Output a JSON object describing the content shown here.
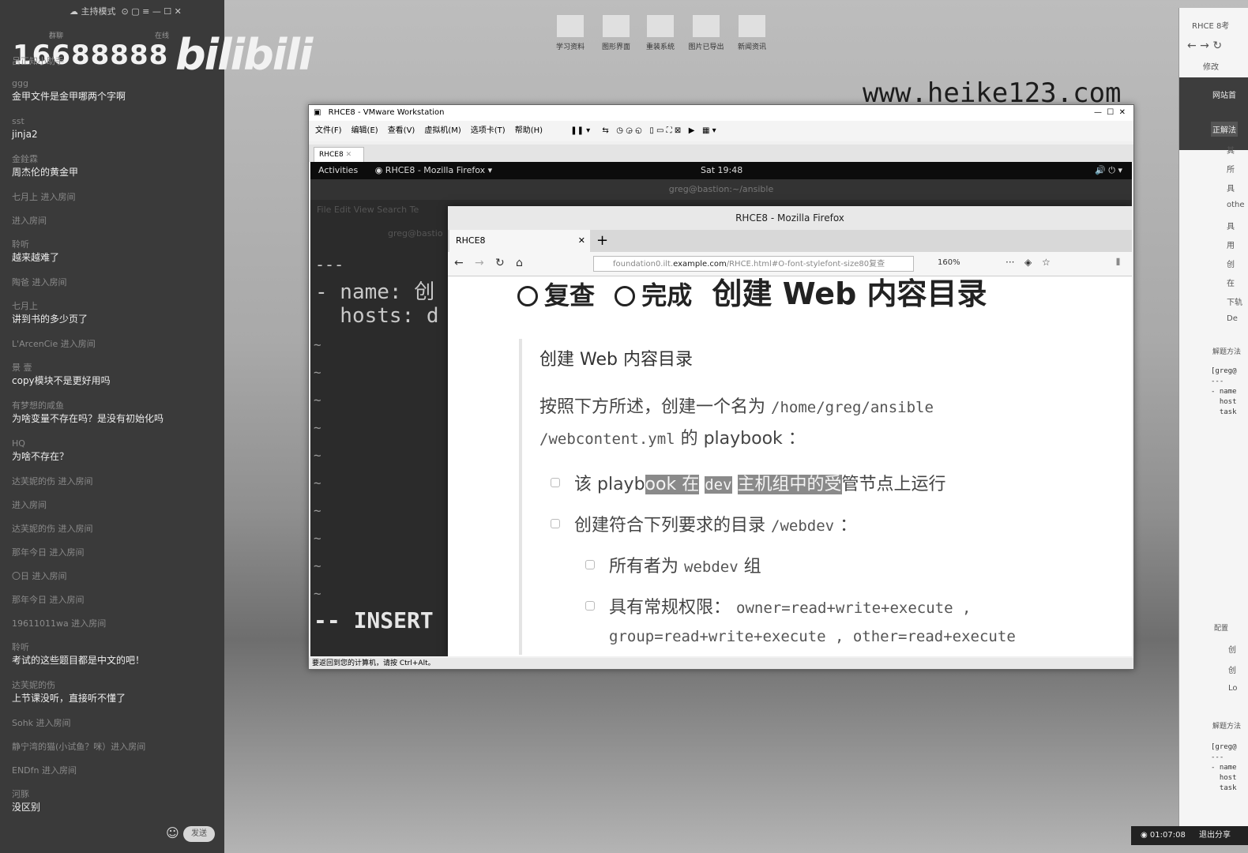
{
  "chat": {
    "top_label": "主持模式",
    "hdr_left": "群聊",
    "hdr_right": "在线",
    "counter": "16688888",
    "logo": "bilibili",
    "messages": [
      {
        "user": "吕正知小助手",
        "text": "",
        "join": ""
      },
      {
        "user": "ggg",
        "text": "金甲文件是金甲哪两个字啊",
        "join": ""
      },
      {
        "user": "sst",
        "text": "jinja2",
        "join": ""
      },
      {
        "user": "金銓霖",
        "text": "周杰伦的黄金甲",
        "join": ""
      },
      {
        "user": "",
        "text": "",
        "join": "七月上 进入房间"
      },
      {
        "user": "",
        "text": "",
        "join": "进入房间"
      },
      {
        "user": "聆听",
        "text": "越来越难了",
        "join": ""
      },
      {
        "user": "",
        "text": "",
        "join": "陶爸 进入房间"
      },
      {
        "user": "七月上",
        "text": "讲到书的多少页了",
        "join": ""
      },
      {
        "user": "",
        "text": "",
        "join": "L'ArcenCie 进入房间"
      },
      {
        "user": "景 壹",
        "text": "copy模块不是更好用吗",
        "join": ""
      },
      {
        "user": "有梦想的咸鱼",
        "text": "为啥变量不存在吗？是没有初始化吗",
        "join": ""
      },
      {
        "user": "HQ",
        "text": "为啥不存在？",
        "join": ""
      },
      {
        "user": "",
        "text": "",
        "join": "达芙妮的伤 进入房间"
      },
      {
        "user": "",
        "text": "",
        "join": "进入房间"
      },
      {
        "user": "",
        "text": "",
        "join": "达芙妮的伤 进入房间"
      },
      {
        "user": "",
        "text": "",
        "join": "那年今日 进入房间"
      },
      {
        "user": "",
        "text": "",
        "join": "〇日 进入房间"
      },
      {
        "user": "",
        "text": "",
        "join": "那年今日 进入房间"
      },
      {
        "user": "",
        "text": "",
        "join": "19611011wa 进入房间"
      },
      {
        "user": "聆听",
        "text": "考试的这些题目都是中文的吧！",
        "join": ""
      },
      {
        "user": "达芙妮的伤",
        "text": "上节课没听，直接听不懂了",
        "join": ""
      },
      {
        "user": "",
        "text": "",
        "join": "Sohk 进入房间"
      },
      {
        "user": "",
        "text": "",
        "join": "静宁湾的猫(小试鱼？咪）进入房间"
      },
      {
        "user": "",
        "text": "",
        "join": "ENDfn 进入房间"
      },
      {
        "user": "河豚",
        "text": "没区别",
        "join": ""
      }
    ],
    "send_label": "发送"
  },
  "desktop": {
    "icons": [
      "学习资料",
      "图形界面",
      "重装系统",
      "图片已导出",
      "新闻资讯"
    ],
    "watermark": "www.heike123.com"
  },
  "right_browser": {
    "tab_label": "RHCE 8考",
    "fav_label": "修改",
    "nav_label": "网站首",
    "dark_label": "正解法",
    "side_items": [
      "其",
      "所",
      "具",
      "othe",
      "具",
      "用",
      "创",
      "在",
      "下轨",
      "De"
    ],
    "section1": "解题方法",
    "code1": [
      "[greg@",
      "---",
      "- name",
      "  host",
      "  task"
    ],
    "section2": "配置",
    "side_items2": [
      "创",
      "创",
      "Lo"
    ],
    "section3": "解题方法",
    "code2": [
      "[greg@",
      "---",
      "- name",
      "  host",
      "  task"
    ]
  },
  "bottom_bar": {
    "time": "01:07:08",
    "share": "退出分享"
  },
  "vmware": {
    "title": "RHCE8 - VMware Workstation",
    "menus": [
      "文件(F)",
      "编辑(E)",
      "查看(V)",
      "虚拟机(M)",
      "选项卡(T)",
      "帮助(H)"
    ],
    "tab": "RHCE8",
    "status": "要返回到您的计算机，请按 Ctrl+Alt。"
  },
  "gnome": {
    "activities": "Activities",
    "app": "RHCE8 - Mozilla Firefox",
    "clock": "Sat 19:48"
  },
  "terminal": {
    "title": "greg@bastion:~/ansible",
    "menu": "File  Edit  View  Search  Te",
    "prompt": "greg@bastio",
    "line1": "---",
    "line2": "- name: 创",
    "line3": "  hosts: d",
    "insert": "-- INSERT"
  },
  "firefox": {
    "window_title": "RHCE8 - Mozilla Firefox",
    "tab": "RHCE8",
    "url_pre": "foundation0.ilt.",
    "url_domain": "example.com",
    "url_post": "/RHCE.html#O-font-stylefont-size80复查",
    "zoom": "160%",
    "heading_review": "复查",
    "heading_done": "完成",
    "heading_title": "创建 Web 内容目录",
    "subheading": "创建 Web 内容目录",
    "intro_text": "按照下方所述，创建一个名为",
    "intro_path1": "/home/greg/ansible",
    "intro_path2": "/webcontent.yml",
    "intro_tail": "的 playbook ：",
    "b1_pre": "该 playb",
    "b1_hl1": "ook 在",
    "b1_code": "dev",
    "b1_hl2": "主机组中的受",
    "b1_post": "管节点上运行",
    "b2_text": "创建符合下列要求的目录",
    "b2_code": "/webdev",
    "b2_tail": "：",
    "s1_text": "所有者为",
    "s1_code": "webdev",
    "s1_tail": "组",
    "s2_text": "具有常规权限：",
    "s2_code1": "owner=read+write+execute ,",
    "s2_code2": "group=read+write+execute , other=read+execute"
  }
}
